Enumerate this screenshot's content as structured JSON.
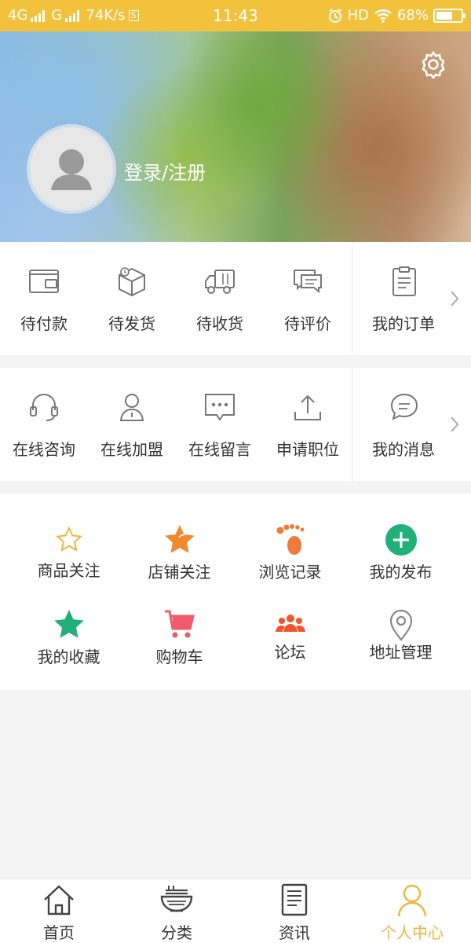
{
  "status_bar": {
    "network1": "4G",
    "network2": "G",
    "speed": "74K/s",
    "s_badge": "S",
    "time": "11:43",
    "hd": "HD",
    "battery": "68%",
    "battery_level": 0.68
  },
  "profile": {
    "login_label": "登录/注册"
  },
  "orders": {
    "items": [
      {
        "label": "待付款",
        "icon": "wallet-icon"
      },
      {
        "label": "待发货",
        "icon": "package-icon"
      },
      {
        "label": "待收货",
        "icon": "truck-icon"
      },
      {
        "label": "待评价",
        "icon": "comment-icon"
      }
    ],
    "all_label": "我的订单",
    "all_icon": "clipboard-icon"
  },
  "services": {
    "items": [
      {
        "label": "在线咨询",
        "icon": "headset-icon"
      },
      {
        "label": "在线加盟",
        "icon": "user-join-icon"
      },
      {
        "label": "在线留言",
        "icon": "message-dots-icon"
      },
      {
        "label": "申请职位",
        "icon": "upload-icon"
      }
    ],
    "all_label": "我的消息",
    "all_icon": "chat-bubble-icon"
  },
  "shortcuts": {
    "items": [
      {
        "label": "商品关注",
        "icon": "star-outline-icon",
        "color": "#f0b63b"
      },
      {
        "label": "店铺关注",
        "icon": "star-filled-icon",
        "color": "#f08a2c"
      },
      {
        "label": "浏览记录",
        "icon": "footprint-icon",
        "color": "#f07a3a"
      },
      {
        "label": "我的发布",
        "icon": "plus-circle-icon",
        "color": "#22b07a"
      },
      {
        "label": "我的收藏",
        "icon": "star-green-icon",
        "color": "#22b07a"
      },
      {
        "label": "购物车",
        "icon": "cart-icon",
        "color": "#f05a6a"
      },
      {
        "label": "论坛",
        "icon": "people-icon",
        "color": "#f0552e"
      },
      {
        "label": "地址管理",
        "icon": "location-pin-icon",
        "color": "#888888"
      }
    ]
  },
  "bottom_nav": {
    "tabs": [
      {
        "label": "首页",
        "icon": "home-icon"
      },
      {
        "label": "分类",
        "icon": "bowl-icon"
      },
      {
        "label": "资讯",
        "icon": "news-icon"
      },
      {
        "label": "个人中心",
        "icon": "person-icon",
        "active": true
      }
    ],
    "active_color": "#f0b63b"
  },
  "colors": {
    "status_bar": "#f2c23d",
    "accent": "#f0b63b"
  }
}
